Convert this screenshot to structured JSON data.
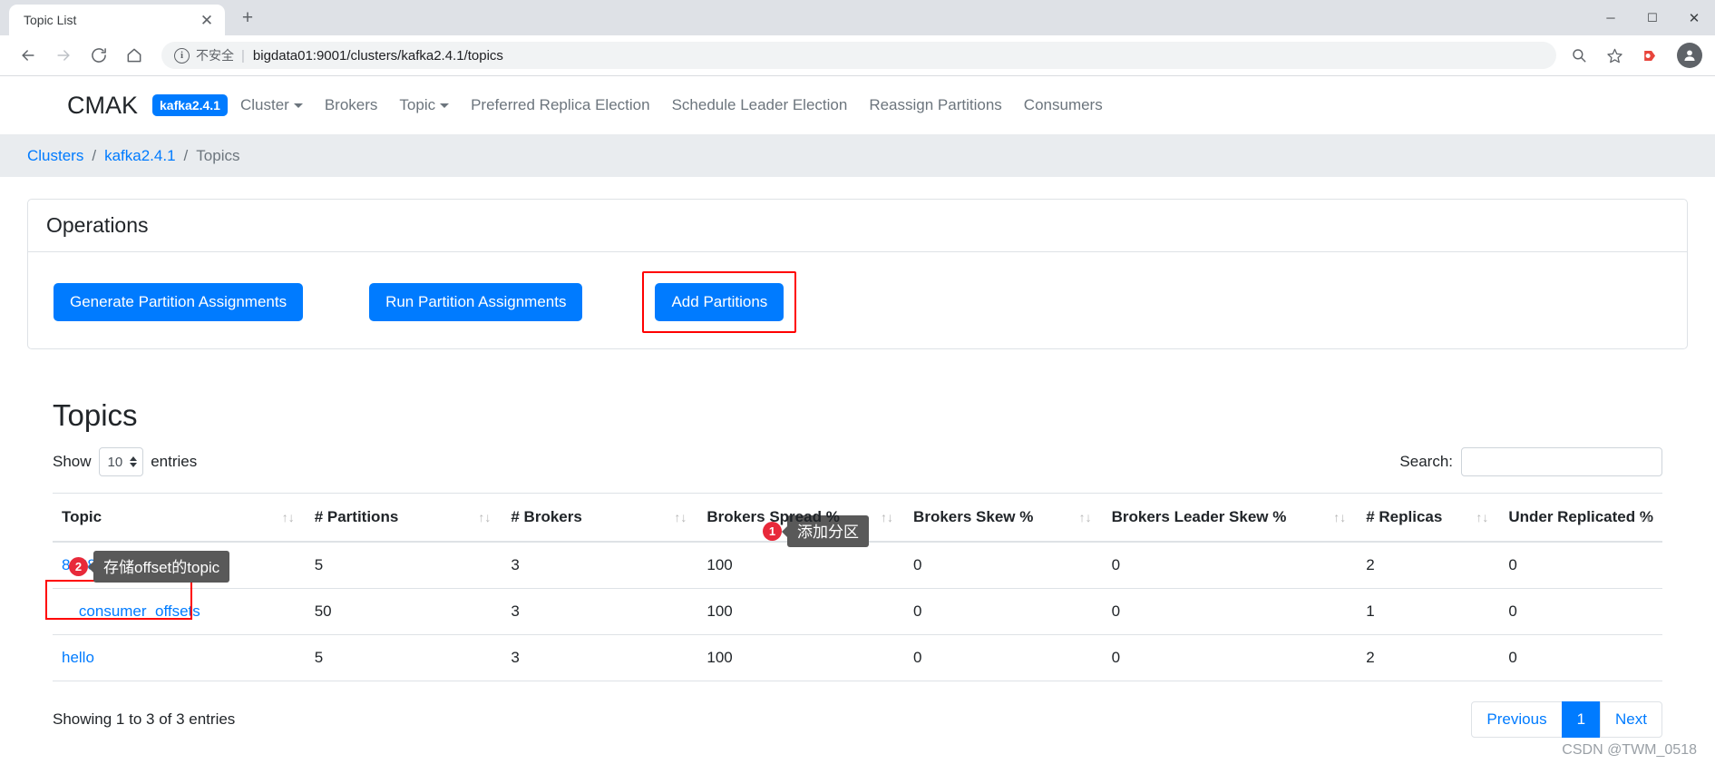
{
  "browser": {
    "tab_title": "Topic List",
    "close_icon": "close-icon",
    "newtab_icon": "+",
    "window_minimize": "─",
    "window_maximize": "❐",
    "window_close": "✕",
    "back_icon": "back-arrow-icon",
    "forward_icon": "forward-arrow-icon",
    "reload_icon": "reload-icon",
    "home_icon": "home-icon",
    "security_label": "不安全",
    "url": "bigdata01:9001/clusters/kafka2.4.1/topics",
    "zoom_icon": "zoom-icon",
    "bookmark_icon": "star-icon",
    "extension_icon": "extension-icon",
    "profile_icon": "profile-avatar-icon"
  },
  "navbar": {
    "brand": "CMAK",
    "cluster_badge": "kafka2.4.1",
    "links": [
      {
        "label": "Cluster",
        "has_caret": true
      },
      {
        "label": "Brokers",
        "has_caret": false
      },
      {
        "label": "Topic",
        "has_caret": true
      },
      {
        "label": "Preferred Replica Election",
        "has_caret": false
      },
      {
        "label": "Schedule Leader Election",
        "has_caret": false
      },
      {
        "label": "Reassign Partitions",
        "has_caret": false
      },
      {
        "label": "Consumers",
        "has_caret": false
      }
    ]
  },
  "breadcrumb": {
    "clusters": "Clusters",
    "cluster": "kafka2.4.1",
    "current": "Topics",
    "separator": "/"
  },
  "operations": {
    "title": "Operations",
    "buttons": [
      {
        "label": "Generate Partition Assignments",
        "highlighted": false
      },
      {
        "label": "Run Partition Assignments",
        "highlighted": false
      },
      {
        "label": "Add Partitions",
        "highlighted": true
      }
    ]
  },
  "annotations": [
    {
      "number": "1",
      "text": "添加分区",
      "target": "Add Partitions"
    },
    {
      "number": "2",
      "text": "存储offset的topic",
      "target": "__consumer_offsets"
    }
  ],
  "topics": {
    "title": "Topics",
    "show_label": "Show",
    "page_length": "10",
    "entries_label": "entries",
    "search_label": "Search:",
    "search_value": "",
    "search_placeholder": "",
    "columns": [
      "Topic",
      "# Partitions",
      "# Brokers",
      "Brokers Spread %",
      "Brokers Skew %",
      "Brokers Leader Skew %",
      "# Replicas",
      "Under Replicated %"
    ],
    "sort_icon": "↑↓",
    "rows": [
      {
        "topic": "88888888",
        "partitions": "5",
        "brokers": "3",
        "spread": "100",
        "skew": "0",
        "leader_skew": "0",
        "replicas": "2",
        "under_replicated": "0"
      },
      {
        "topic": "__consumer_offsets",
        "partitions": "50",
        "brokers": "3",
        "spread": "100",
        "skew": "0",
        "leader_skew": "0",
        "replicas": "1",
        "under_replicated": "0"
      },
      {
        "topic": "hello",
        "partitions": "5",
        "brokers": "3",
        "spread": "100",
        "skew": "0",
        "leader_skew": "0",
        "replicas": "2",
        "under_replicated": "0"
      }
    ],
    "showing_text": "Showing 1 to 3 of 3 entries",
    "pagination": {
      "previous": "Previous",
      "pages": [
        "1"
      ],
      "next": "Next"
    }
  },
  "watermark": "CSDN @TWM_0518",
  "colors": {
    "primary": "#007bff",
    "highlight": "#ff0000",
    "badge": "#e8293a",
    "tooltip_bg": "#595959",
    "breadcrumb_bg": "#e9ecef"
  }
}
